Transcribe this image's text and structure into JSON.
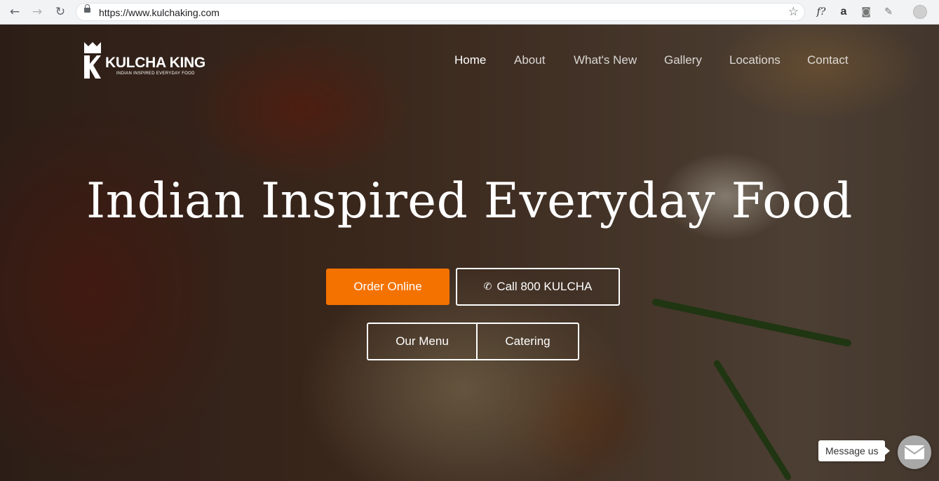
{
  "browser": {
    "url": "https://www.kulchaking.com",
    "back_icon": "←",
    "forward_icon": "→",
    "reload_icon": "↻",
    "star_icon": "☆",
    "extensions": [
      {
        "name": "font-extension-icon",
        "glyph": "f?"
      },
      {
        "name": "amazon-icon",
        "glyph": "a"
      },
      {
        "name": "camera-icon",
        "glyph": "◙"
      },
      {
        "name": "dropper-icon",
        "glyph": "✎"
      }
    ]
  },
  "site": {
    "brand": {
      "name": "KULCHA KING",
      "tagline": "INDIAN INSPIRED EVERYDAY FOOD"
    },
    "nav": [
      {
        "label": "Home",
        "active": true
      },
      {
        "label": "About",
        "active": false
      },
      {
        "label": "What's New",
        "active": false
      },
      {
        "label": "Gallery",
        "active": false
      },
      {
        "label": "Locations",
        "active": false
      },
      {
        "label": "Contact",
        "active": false
      }
    ],
    "headline": "Indian Inspired Everyday Food",
    "buttons": {
      "order": "Order Online",
      "call": "Call 800 KULCHA",
      "menu": "Our Menu",
      "catering": "Catering"
    },
    "chat": {
      "label": "Message us",
      "icon": "envelope-icon"
    }
  },
  "colors": {
    "accent": "#f47200",
    "chat_button": "#a8a8a8"
  }
}
